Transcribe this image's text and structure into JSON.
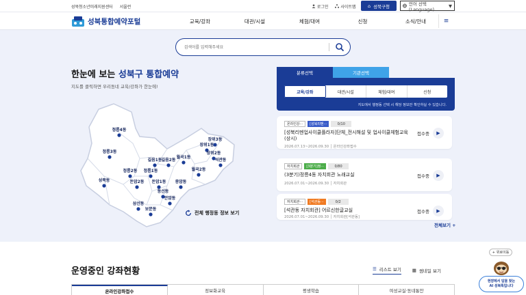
{
  "util": {
    "left_links": [
      "성북청소년미래지원센터",
      "서울런"
    ],
    "login": "로그인",
    "sitemap": "사이트맵",
    "seongbuk": "성북구청",
    "language": "언어 선택 (Language)"
  },
  "header": {
    "logo": "성북통합예약포털",
    "nav": [
      "교육/강좌",
      "대관/시설",
      "체험/대여",
      "신청",
      "소식/안내"
    ]
  },
  "search": {
    "placeholder": "검색어를 입력해주세요"
  },
  "hero": {
    "title_prefix": "한눈에 보는 ",
    "title_highlight": "성북구 통합예약",
    "subtitle": "지도를 클릭하면 우리동네 교육/강좌가 한눈에!",
    "full_info": "전체 행정동 정보 보기"
  },
  "map": {
    "dongs": [
      "정릉4동",
      "정릉3동",
      "성북동",
      "정릉2동",
      "정릉1동",
      "돈암2동",
      "돈암1동",
      "길음1동",
      "길음2동",
      "월곡1동",
      "장위1동",
      "장위3동",
      "장위2동",
      "석관동",
      "월곡2동",
      "종암동",
      "안암동",
      "보문동",
      "삼선동",
      "동선동"
    ]
  },
  "panel": {
    "tabs": [
      "분류선택",
      "기관선택"
    ],
    "categories": [
      "교육/강좌",
      "대관/시설",
      "체험/대여",
      "신청"
    ],
    "hint": "지도에서 행정동 선택 시 해당 정보만 확인하실 수 있습니다."
  },
  "cards": [
    {
      "org": "온라인강···",
      "tag": "[성북리멘···",
      "count": "0/10",
      "title": "[성북리멘업사이클플라자]단체_전시해설 및 업사이클체험교육 (상시)",
      "date": "2026.07.13~2026.09.30",
      "place": "온라인강좌접수",
      "status": "접수중"
    },
    {
      "org": "자치회관",
      "tag": "[3분기]정···",
      "count": "0/80",
      "title": "(3분기)정릉4동 자치회관 노래교실",
      "date": "2026.07.01~2026.09.30",
      "place": "자치회관",
      "status": "접수중"
    },
    {
      "org": "자치회관···",
      "tag": "[석관동···",
      "count": "0/2",
      "title": "[석관동 자치회관] 어르신한글교실",
      "date": "2026.07.01~2026.09.30",
      "place": "자치회관[석관동]",
      "status": "접수중"
    }
  ],
  "more": "전체보기 +",
  "bottom": {
    "title": "운영중인 강좌현황",
    "list_view": "리스트 보기",
    "thumb_view": "썸네일 보기",
    "tabs": [
      "온라인강좌접수",
      "정보화교육",
      "평생학습",
      "여성교실·동네통안"
    ]
  },
  "float": {
    "top": "위로이동",
    "bubble_line1": "현장에서 답을 찾는",
    "bubble_line2": "AI 성북톡입니다"
  },
  "colors": {
    "primary": "#1a3c96",
    "accent": "#3fa3e8",
    "map_fill": "#ffffff",
    "map_dot": "#1a3c96"
  }
}
